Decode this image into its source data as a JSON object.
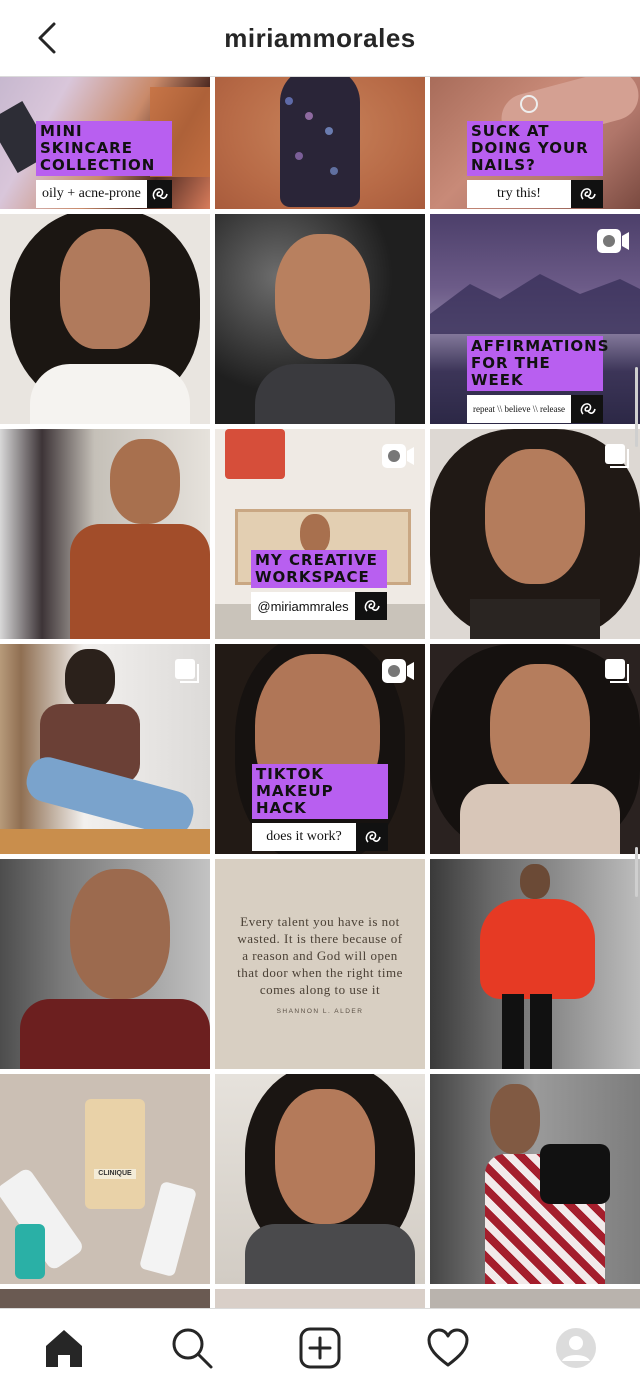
{
  "header": {
    "username": "miriammorales",
    "back_icon": "chevron-left-icon"
  },
  "posts": [
    {
      "id": "p1",
      "headline": "MINI SKINCARE COLLECTION",
      "caption": "oily + acne-prone"
    },
    {
      "id": "p3",
      "headline": "SUCK AT DOING YOUR NAILS?",
      "caption": "try this!"
    },
    {
      "id": "p6",
      "headline": "AFFIRMATIONS FOR THE WEEK",
      "caption": "repeat \\\\ believe \\\\ release",
      "type_icon": "reels-icon"
    },
    {
      "id": "p8",
      "headline": "MY CREATIVE WORKSPACE",
      "caption": "@miriammrales",
      "type_icon": "reels-icon"
    },
    {
      "id": "p11",
      "headline": "TIKTOK MAKEUP HACK",
      "caption": "does it work?",
      "type_icon": "reels-icon"
    },
    {
      "id": "p14",
      "quote": "Every talent you have is not wasted. It is there because of a reason and God will open that door when the right time comes along to use it",
      "author": "SHANNON L. ALDER"
    },
    {
      "id": "p15b",
      "brand_text": "CLINIQUE"
    }
  ],
  "tabbar": {
    "items": [
      "home-icon",
      "search-icon",
      "new-post-icon",
      "activity-heart-icon",
      "profile-avatar"
    ]
  },
  "colors": {
    "accent_purple": "#b85ff0",
    "divider": "#dbdbdb",
    "text_primary": "#262626"
  }
}
